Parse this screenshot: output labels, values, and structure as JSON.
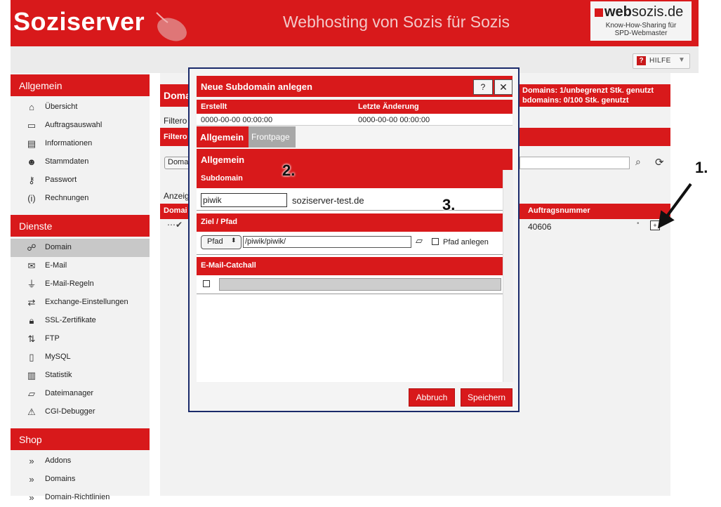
{
  "header": {
    "logo": "Soziserver",
    "tagline": "Webhosting von Sozis für Sozis",
    "partner": {
      "name_bold": "web",
      "name_rest": "sozis.de",
      "sub1": "Know-How-Sharing für",
      "sub2": "SPD-Webmaster"
    }
  },
  "help_button": {
    "label": "HILFE",
    "icon": "?"
  },
  "sidebar": {
    "sections": [
      {
        "title": "Allgemein",
        "items": [
          {
            "label": "Übersicht",
            "icon": "home-icon"
          },
          {
            "label": "Auftragsauswahl",
            "icon": "window-icon"
          },
          {
            "label": "Informationen",
            "icon": "document-icon"
          },
          {
            "label": "Stammdaten",
            "icon": "user-icon"
          },
          {
            "label": "Passwort",
            "icon": "key-icon"
          },
          {
            "label": "Rechnungen",
            "icon": "invoice-icon"
          }
        ]
      },
      {
        "title": "Dienste",
        "items": [
          {
            "label": "Domain",
            "icon": "domain-icon",
            "active": true
          },
          {
            "label": "E-Mail",
            "icon": "mail-icon"
          },
          {
            "label": "E-Mail-Regeln",
            "icon": "filter-icon"
          },
          {
            "label": "Exchange-Einstellungen",
            "icon": "exchange-icon"
          },
          {
            "label": "SSL-Zertifikate",
            "icon": "lock-icon"
          },
          {
            "label": "FTP",
            "icon": "ftp-icon"
          },
          {
            "label": "MySQL",
            "icon": "database-icon"
          },
          {
            "label": "Statistik",
            "icon": "chart-icon"
          },
          {
            "label": "Dateimanager",
            "icon": "folder-icon"
          },
          {
            "label": "CGI-Debugger",
            "icon": "debug-icon"
          }
        ]
      },
      {
        "title": "Shop",
        "items": [
          {
            "label": "Addons",
            "icon": "arrow-icon"
          },
          {
            "label": "Domains",
            "icon": "arrow-icon"
          },
          {
            "label": "Domain-Richtlinien",
            "icon": "arrow-icon"
          }
        ]
      }
    ]
  },
  "content": {
    "title": "Domai",
    "stat1": "Domains: 1/unbegrenzt Stk. genutzt",
    "stat2": "bdomains: 0/100 Stk. genutzt",
    "filter_label": "Filtero",
    "filter_strip_label": "Filtero",
    "select_label": "Doma",
    "anzeige_label": "Anzeig",
    "th_domain": "Domai",
    "th_order": "Auftragsnummer",
    "row_order": "40606"
  },
  "annotations": [
    "1.",
    "2.",
    "3."
  ],
  "modal": {
    "title": "Neue Subdomain anlegen",
    "help_label": "?",
    "close_label": "✕",
    "created_header": "Erstellt",
    "changed_header": "Letzte Änderung",
    "created_value": "0000-00-00 00:00:00",
    "changed_value": "0000-00-00 00:00:00",
    "tabs": [
      {
        "label": "Allgemein",
        "active": true
      },
      {
        "label": "Frontpage",
        "active": false
      }
    ],
    "section_title": "Allgemein",
    "subdomain_header": "Subdomain",
    "subdomain_value": "piwik",
    "domain_suffix": "soziserver-test.de",
    "target_header": "Ziel / Pfad",
    "path_type": "Pfad",
    "path_value": "/piwik/piwik/",
    "create_path_label": "Pfad anlegen",
    "catchall_header": "E-Mail-Catchall",
    "cancel_label": "Abbruch",
    "save_label": "Speichern"
  },
  "colors": {
    "brand_red": "#d8191b",
    "modal_border": "#1a2a6a"
  }
}
